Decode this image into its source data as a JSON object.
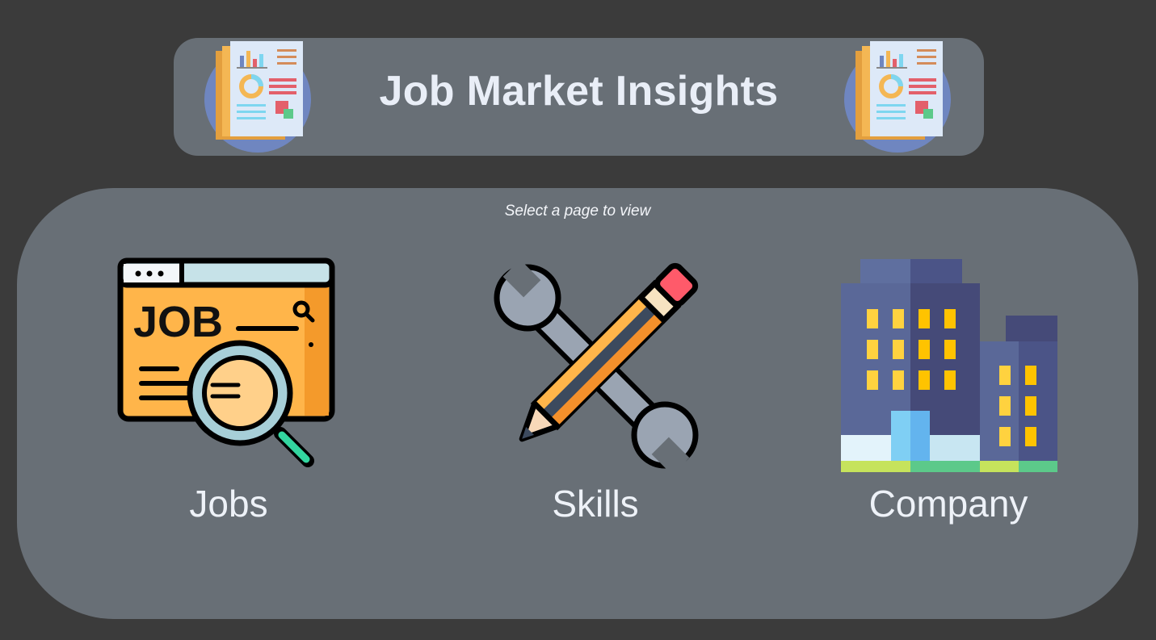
{
  "header": {
    "title": "Job Market Insights",
    "icon_left": "report-document-icon",
    "icon_right": "report-document-icon"
  },
  "main": {
    "subtitle": "Select a page to view",
    "pages": [
      {
        "label": "Jobs",
        "icon": "job-search-icon"
      },
      {
        "label": "Skills",
        "icon": "wrench-pencil-icon"
      },
      {
        "label": "Company",
        "icon": "office-building-icon"
      }
    ]
  },
  "colors": {
    "background": "#3b3b3b",
    "panel": "#686f76",
    "text": "#eef2f8"
  }
}
